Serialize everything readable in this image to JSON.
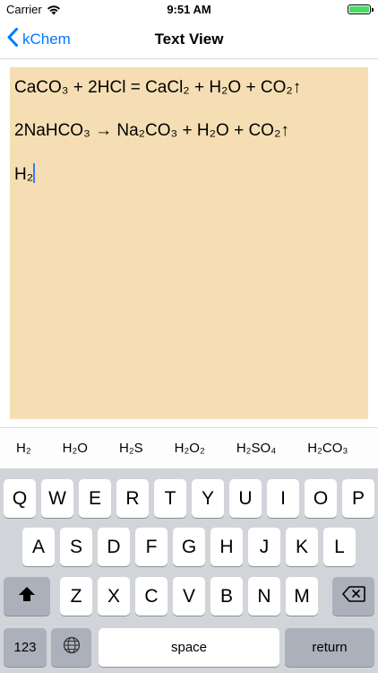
{
  "status_bar": {
    "carrier": "Carrier",
    "time": "9:51 AM"
  },
  "nav": {
    "back_label": "kChem",
    "title": "Text View"
  },
  "editor": {
    "lines": [
      "CaCO₃ + 2HCl = CaCl₂ + H₂O + CO₂↑",
      "2NaHCO₃ → Na₂CO₃ + H₂O + CO₂↑",
      "H₂"
    ],
    "background": "#f5deb3"
  },
  "suggestions": [
    "H₂",
    "H₂O",
    "H₂S",
    "H₂O₂",
    "H₂SO₄",
    "H₂CO₃",
    "H₂"
  ],
  "keyboard": {
    "row1": [
      "Q",
      "W",
      "E",
      "R",
      "T",
      "Y",
      "U",
      "I",
      "O",
      "P"
    ],
    "row2": [
      "A",
      "S",
      "D",
      "F",
      "G",
      "H",
      "J",
      "K",
      "L"
    ],
    "row3": [
      "Z",
      "X",
      "C",
      "V",
      "B",
      "N",
      "M"
    ],
    "numbers_label": "123",
    "space_label": "space",
    "return_label": "return"
  },
  "colors": {
    "accent": "#007aff",
    "battery": "#4cd964",
    "keyboard_bg": "#d1d4d9"
  }
}
